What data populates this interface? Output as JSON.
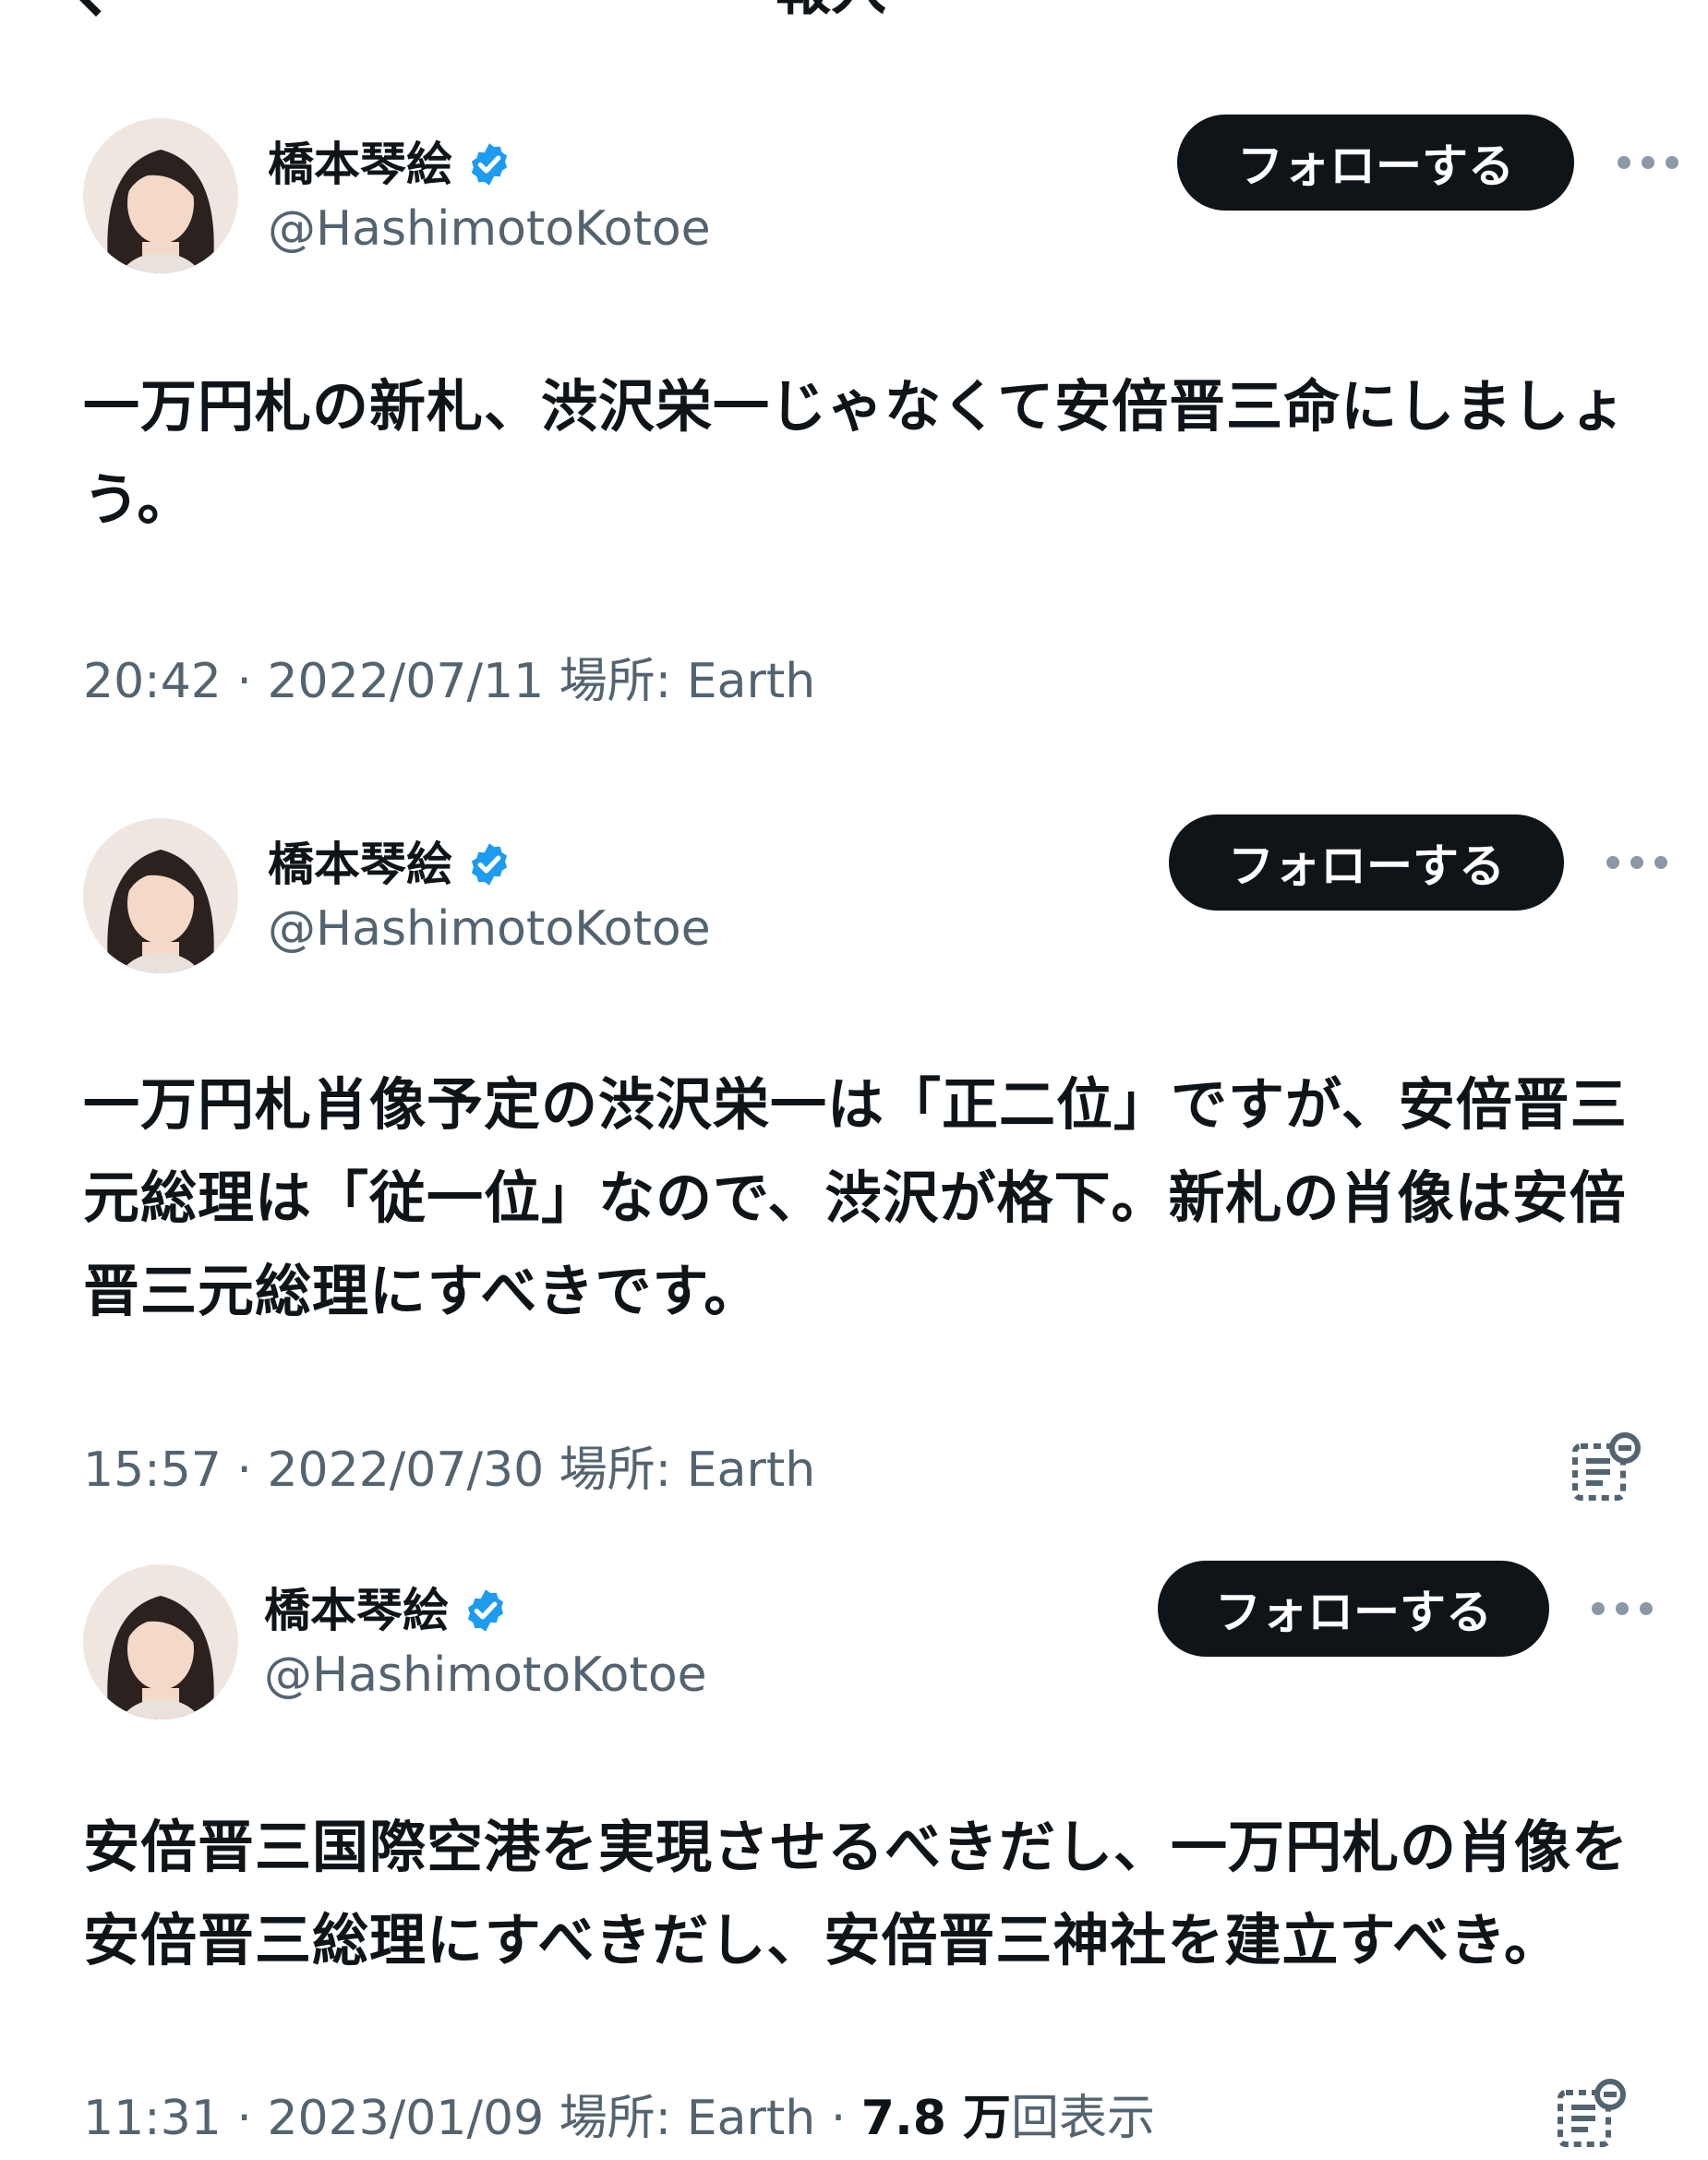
{
  "header": {
    "back_icon": "chevron-left-icon",
    "title_fragment": "報入"
  },
  "tweets": [
    {
      "author_name": "橋本琴絵",
      "handle": "@HashimotoKotoe",
      "follow_label": "フォローする",
      "text_lines": [
        "一万円札の新札、渋沢栄一じゃなくて安倍晋三命にしましょ",
        "う。"
      ],
      "meta": "20:42 · 2022/07/11  場所: Earth",
      "has_note_icon": false
    },
    {
      "author_name": "橋本琴絵",
      "handle": "@HashimotoKotoe",
      "follow_label": "フォローする",
      "text_lines": [
        "一万円札肖像予定の渋沢栄一は「正二位」ですが、安倍晋三",
        "元総理は「従一位」なので、渋沢が格下。新札の肖像は安倍",
        "晋三元総理にすべきです。"
      ],
      "meta": "15:57 · 2022/07/30  場所: Earth",
      "has_note_icon": true
    },
    {
      "author_name": "橋本琴絵",
      "handle": "@HashimotoKotoe",
      "follow_label": "フォローする",
      "text_lines": [
        "安倍晋三国際空港を実現させるべきだし、一万円札の肖像を",
        "安倍晋三総理にすべきだし、安倍晋三神社を建立すべき。"
      ],
      "meta": "11:31 · 2023/01/09  場所: Earth · ",
      "views_count": "7.8 万",
      "views_label": "回表示",
      "has_note_icon": true
    }
  ],
  "colors": {
    "text_primary": "#0f1419",
    "text_secondary": "#536471",
    "verified_blue": "#1d9bf0",
    "follow_button_bg": "#0f1419",
    "follow_button_text": "#ffffff"
  },
  "icons": {
    "verified": "verified-badge-icon",
    "more": "more-options-icon",
    "note": "community-note-icon"
  }
}
